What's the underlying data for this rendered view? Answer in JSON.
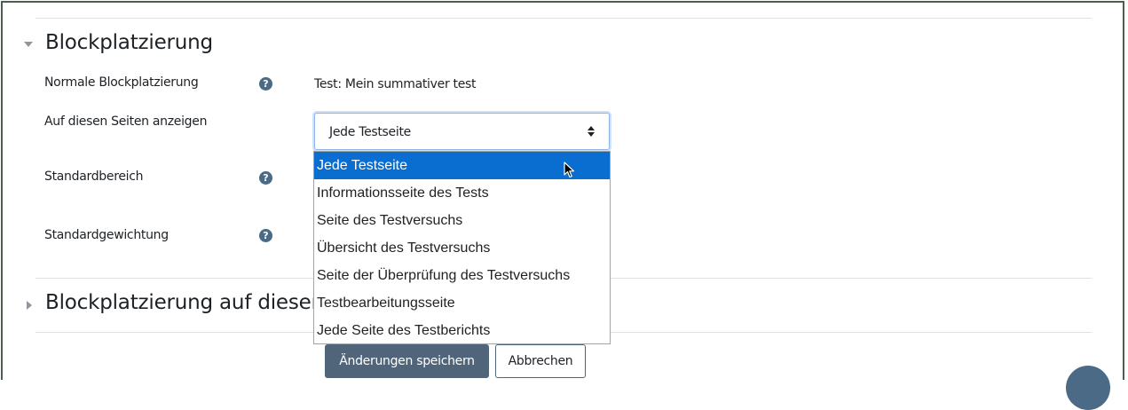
{
  "section1": {
    "title": "Blockplatzierung"
  },
  "fields": {
    "normal": {
      "label": "Normale Blockplatzierung",
      "value": "Test: Mein summativer test"
    },
    "pages": {
      "label": "Auf diesen Seiten anzeigen"
    },
    "region": {
      "label": "Standardbereich"
    },
    "weight": {
      "label": "Standardgewichtung"
    }
  },
  "help_icon": "question-circle-icon",
  "help_glyph": "?",
  "select": {
    "selected": "Jede Testseite",
    "options": [
      "Jede Testseite",
      "Informationsseite des Tests",
      "Seite des Testversuchs",
      "Übersicht des Testversuchs",
      "Seite der Überprüfung des Testversuchs",
      "Testbearbeitungsseite",
      "Jede Seite des Testberichts"
    ]
  },
  "section2": {
    "title": "Blockplatzierung auf dieser"
  },
  "buttons": {
    "save": "Änderungen speichern",
    "cancel": "Abbrechen"
  },
  "colors": {
    "accent": "#0a6ed1",
    "primary_button": "#51657a",
    "help_icon": "#4b6a85",
    "frame": "#4b5e4f"
  }
}
